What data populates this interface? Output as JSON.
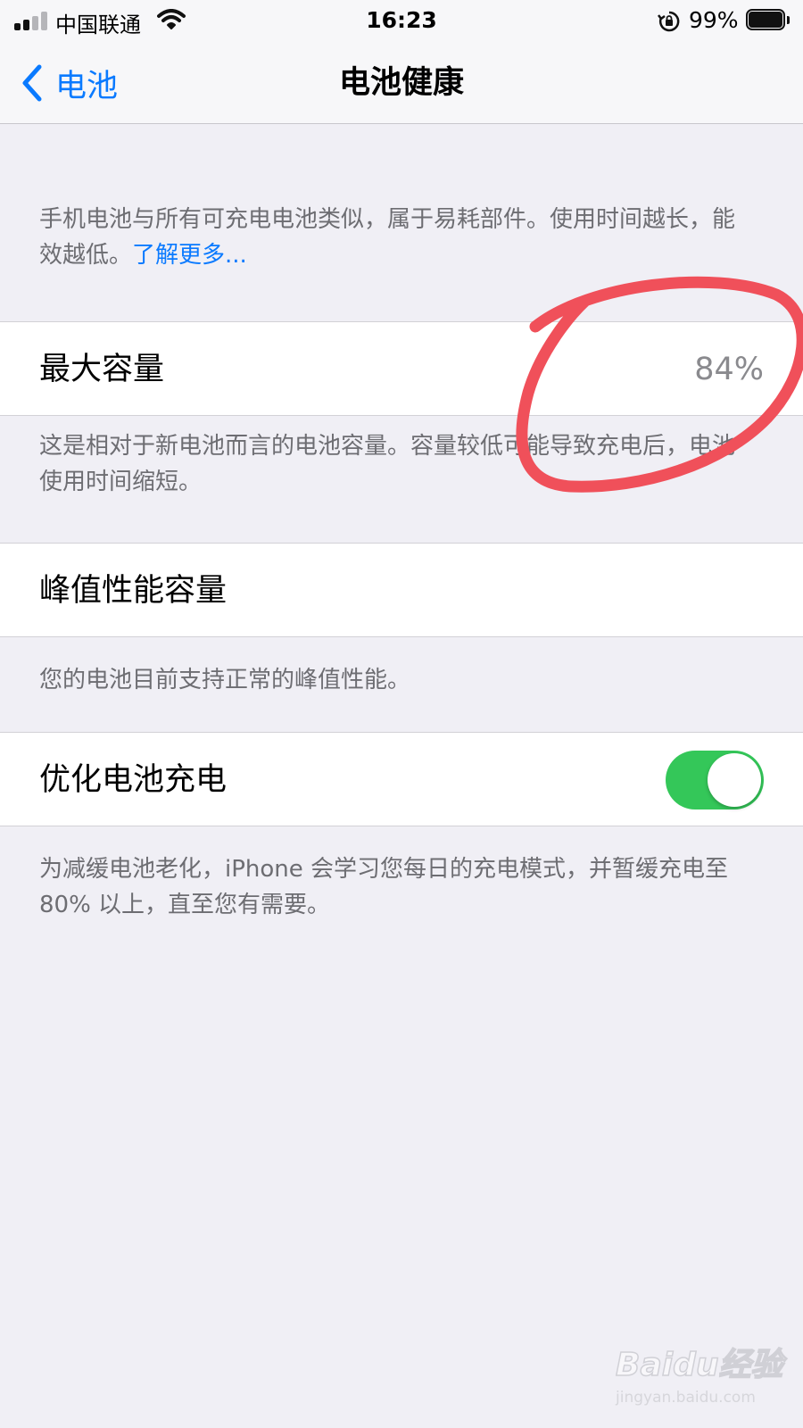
{
  "status_bar": {
    "carrier": "中国联通",
    "time": "16:23",
    "battery_percent_text": "99%",
    "battery_level": 0.99
  },
  "nav": {
    "back_label": "电池",
    "title": "电池健康"
  },
  "intro": {
    "text": "手机电池与所有可充电电池类似，属于易耗部件。使用时间越长，能效越低。",
    "link": "了解更多..."
  },
  "max_capacity": {
    "label": "最大容量",
    "value": "84%",
    "note": "这是相对于新电池而言的电池容量。容量较低可能导致充电后，电池使用时间缩短。"
  },
  "peak_performance": {
    "label": "峰值性能容量",
    "note": "您的电池目前支持正常的峰值性能。"
  },
  "optimized_charging": {
    "label": "优化电池充电",
    "enabled": true,
    "note": "为减缓电池老化，iPhone 会学习您每日的充电模式，并暂缓充电至 80% 以上，直至您有需要。"
  },
  "watermark": {
    "brand": "Baidu经验",
    "url": "jingyan.baidu.com"
  },
  "colors": {
    "accent": "#0a7aff",
    "toggle_on": "#34c759",
    "annotation": "#f0505a",
    "background": "#f0eff5"
  }
}
